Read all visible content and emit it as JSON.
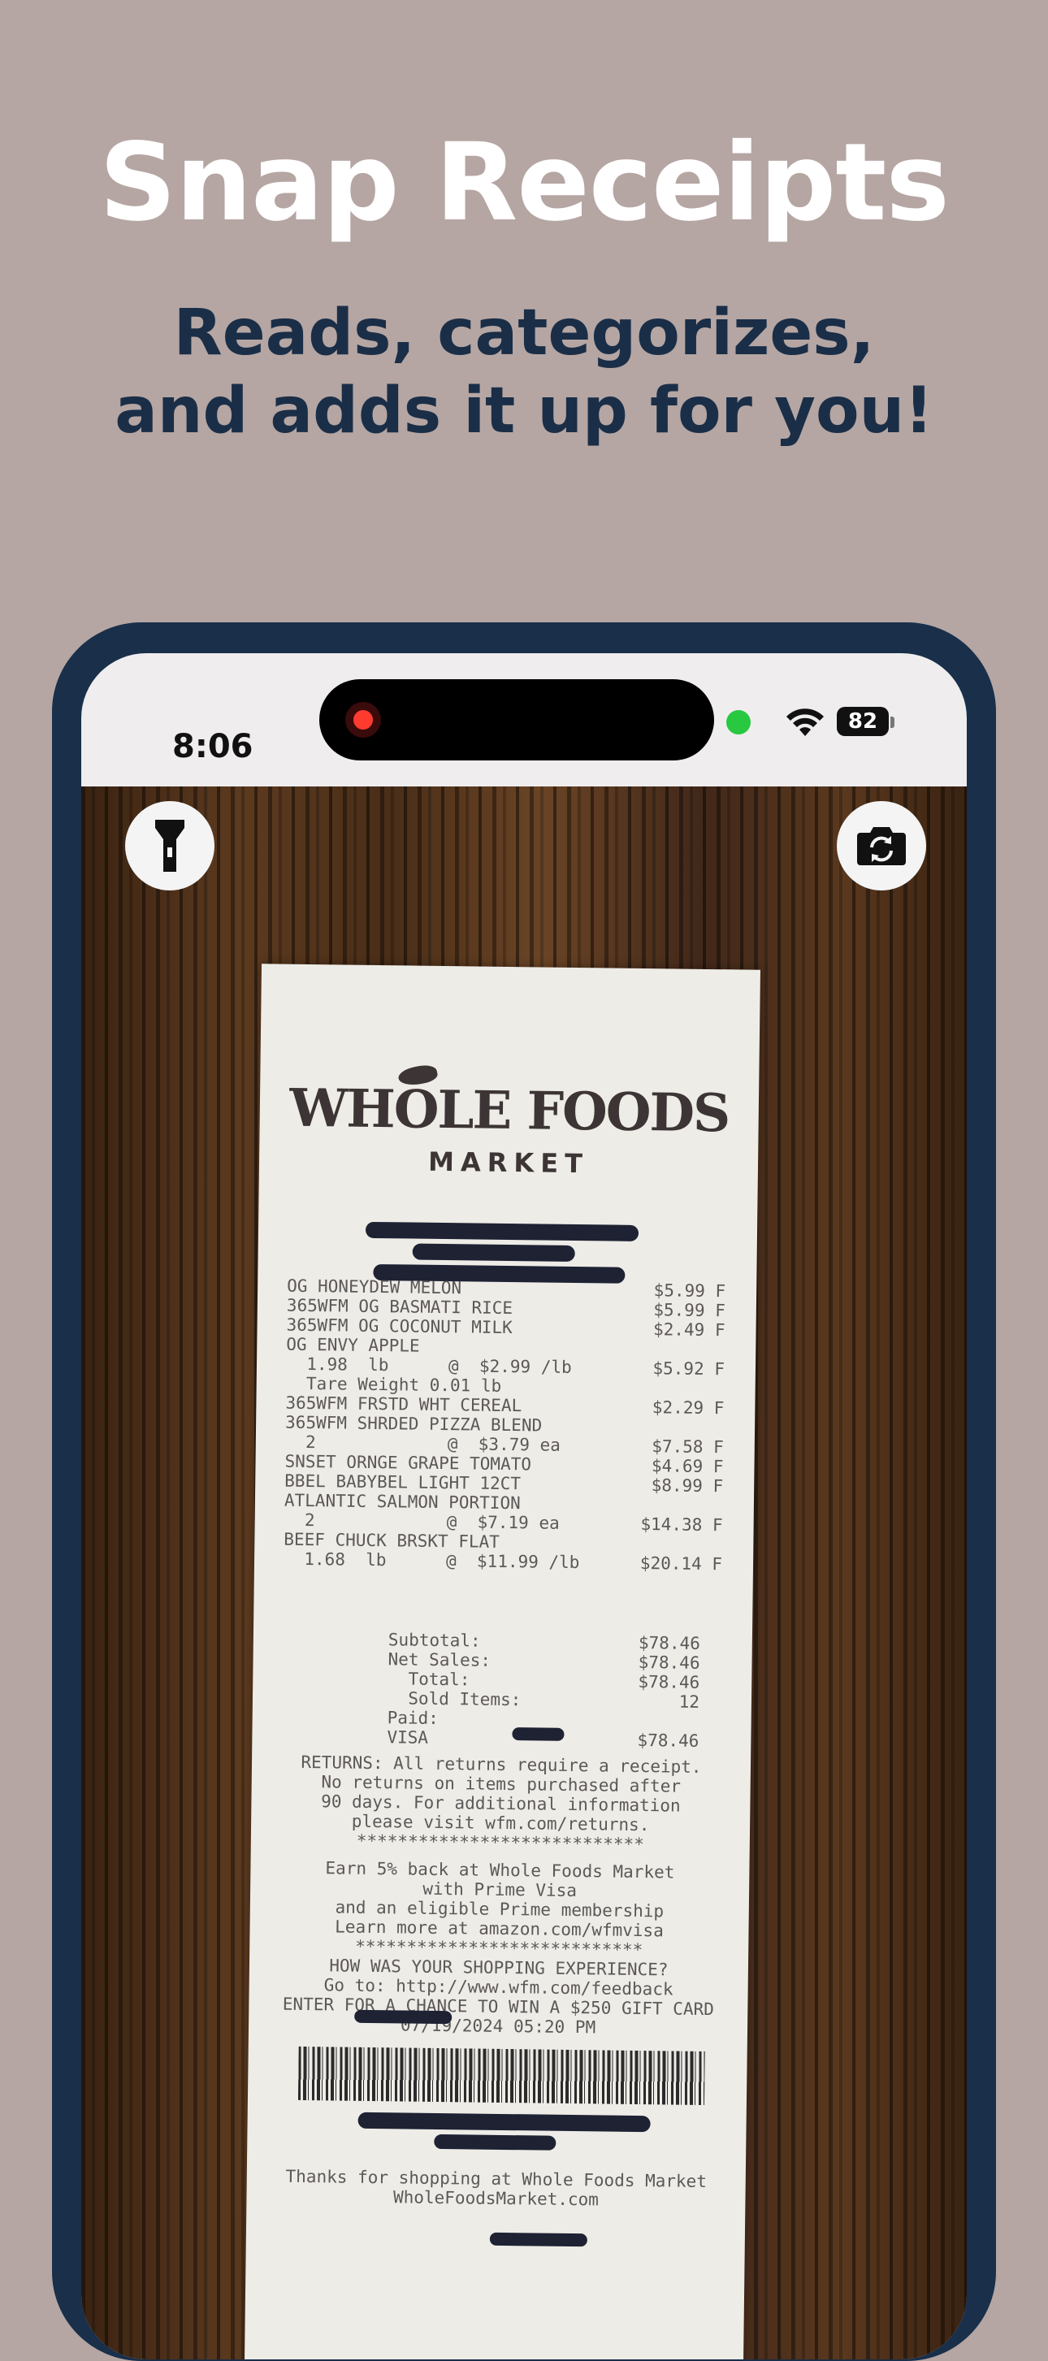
{
  "marketing": {
    "headline": "Snap Receipts",
    "subhead_line1": "Reads, categorizes,",
    "subhead_line2": "and adds it up for you!"
  },
  "status_bar": {
    "time": "8:06",
    "battery": "82"
  },
  "camera": {
    "flashlight_icon": "flashlight-icon",
    "flip_icon": "flip-camera-icon"
  },
  "receipt": {
    "brand": "WHOLE FOODS",
    "brand_sub": "MARKET",
    "items": [
      {
        "left": "OG HONEYDEW MELON",
        "mid": "",
        "right": "$5.99 F"
      },
      {
        "left": "365WFM OG BASMATI RICE",
        "mid": "",
        "right": "$5.99 F"
      },
      {
        "left": "365WFM OG COCONUT MILK",
        "mid": "",
        "right": "$2.49 F"
      },
      {
        "left": "OG ENVY APPLE",
        "mid": "",
        "right": ""
      },
      {
        "left": "  1.98  lb",
        "mid": "@  $2.99 /lb",
        "right": "$5.92 F"
      },
      {
        "left": "  Tare Weight 0.01 lb",
        "mid": "",
        "right": ""
      },
      {
        "left": "365WFM FRSTD WHT CEREAL",
        "mid": "",
        "right": "$2.29 F"
      },
      {
        "left": "365WFM SHRDED PIZZA BLEND",
        "mid": "",
        "right": ""
      },
      {
        "left": "  2",
        "mid": "@  $3.79 ea",
        "right": "$7.58 F"
      },
      {
        "left": "SNSET ORNGE GRAPE TOMATO",
        "mid": "",
        "right": "$4.69 F"
      },
      {
        "left": "BBEL BABYBEL LIGHT 12CT",
        "mid": "",
        "right": "$8.99 F"
      },
      {
        "left": "ATLANTIC SALMON PORTION",
        "mid": "",
        "right": ""
      },
      {
        "left": "  2",
        "mid": "@  $7.19 ea",
        "right": "$14.38 F"
      },
      {
        "left": "BEEF CHUCK BRSKT FLAT",
        "mid": "",
        "right": ""
      },
      {
        "left": "  1.68  lb",
        "mid": "@  $11.99 /lb",
        "right": "$20.14 F"
      }
    ],
    "totals": [
      {
        "label": "Subtotal:",
        "value": "$78.46"
      },
      {
        "label": "Net Sales:",
        "value": "$78.46"
      },
      {
        "label": "  Total:",
        "value": "$78.46"
      },
      {
        "label": "  Sold Items:",
        "value": "12"
      },
      {
        "label": "Paid:",
        "value": ""
      },
      {
        "label": "VISA",
        "value": "$78.46"
      }
    ],
    "returns": [
      "RETURNS: All returns require a receipt.",
      "No returns on items purchased after",
      "90 days. For additional information",
      "please visit wfm.com/returns.",
      "****************************"
    ],
    "promo": [
      "Earn 5% back at Whole Foods Market",
      "with Prime Visa",
      "and an eligible Prime membership",
      "Learn more at amazon.com/wfmvisa"
    ],
    "survey": [
      "****************************",
      "HOW WAS YOUR SHOPPING EXPERIENCE?",
      "Go to: http://www.wfm.com/feedback",
      "ENTER FOR A CHANCE TO WIN A $250 GIFT CARD",
      "07/19/2024 05:20 PM"
    ],
    "thanks": [
      "Thanks for shopping at Whole Foods Market",
      "WholeFoodsMarket.com"
    ]
  }
}
